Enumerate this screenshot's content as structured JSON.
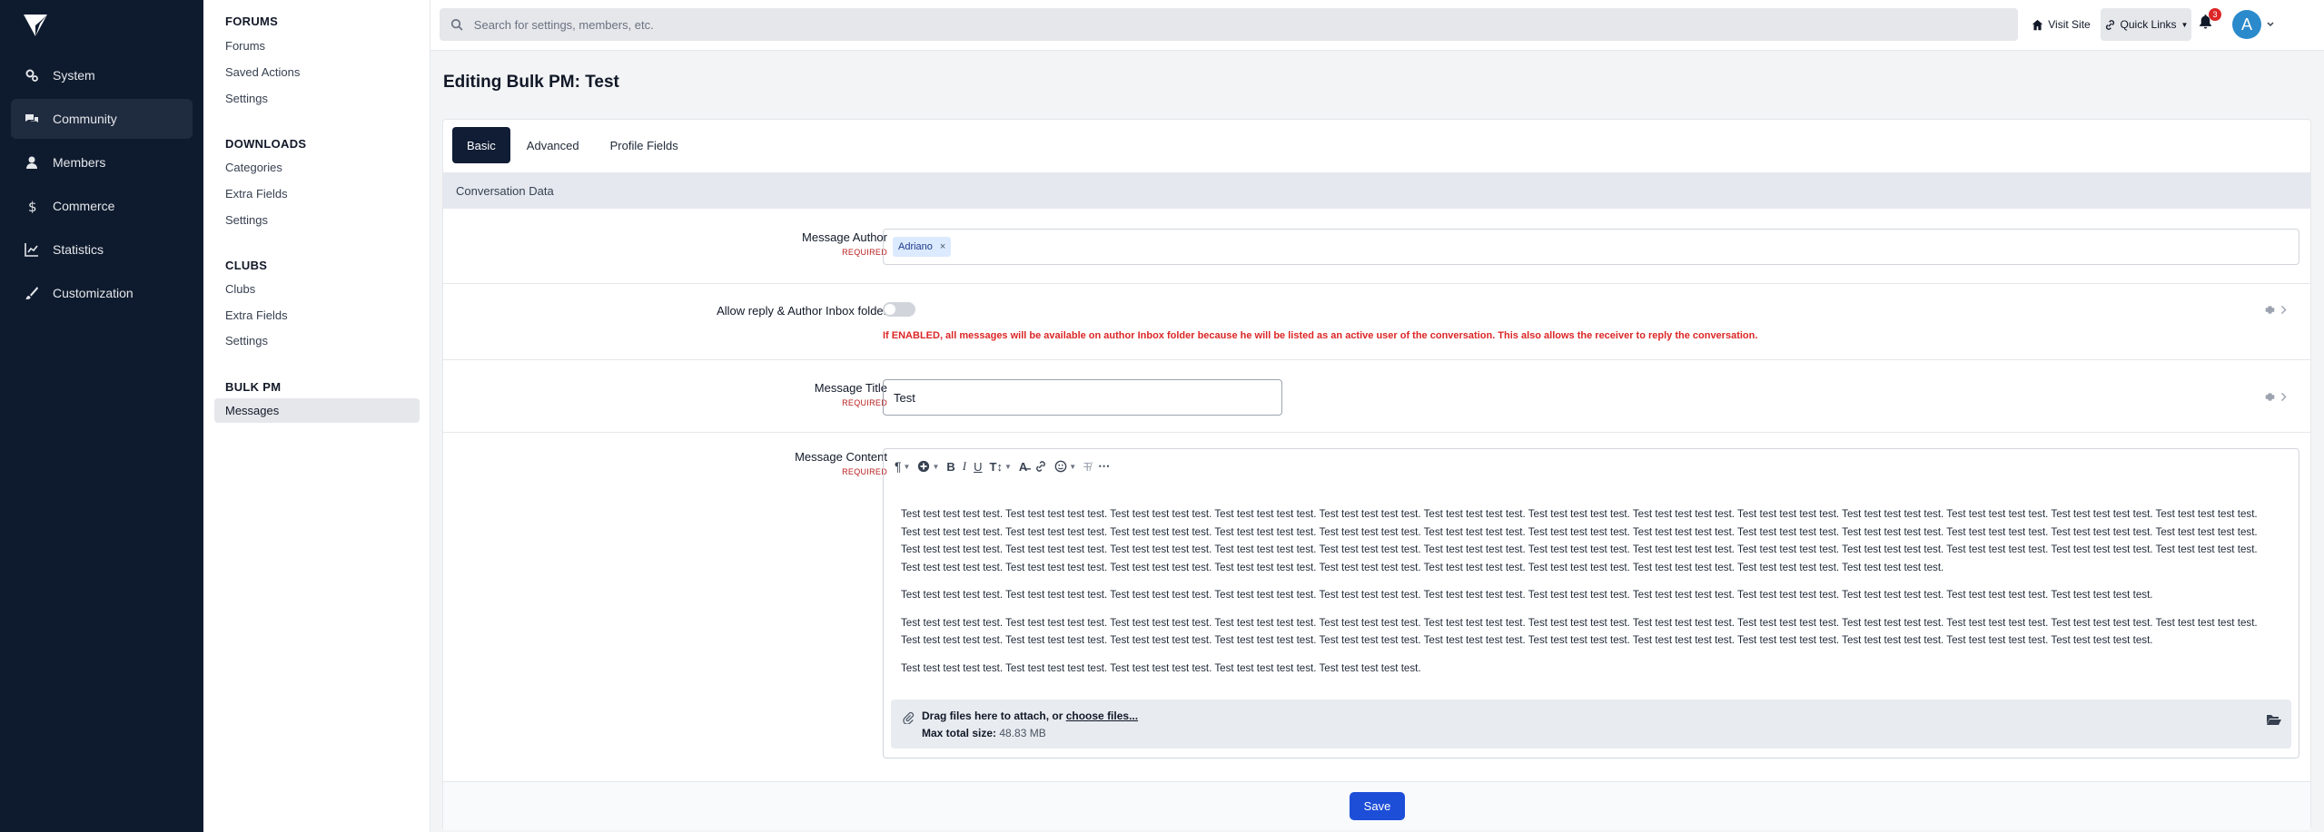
{
  "nav": {
    "items": [
      {
        "label": "System",
        "icon": "gears-icon"
      },
      {
        "label": "Community",
        "icon": "comments-icon",
        "active": true
      },
      {
        "label": "Members",
        "icon": "user-icon"
      },
      {
        "label": "Commerce",
        "icon": "dollar-icon"
      },
      {
        "label": "Statistics",
        "icon": "chart-line-icon"
      },
      {
        "label": "Customization",
        "icon": "paintbrush-icon"
      }
    ]
  },
  "subnav": {
    "groups": [
      {
        "title": "FORUMS",
        "items": [
          "Forums",
          "Saved Actions",
          "Settings"
        ]
      },
      {
        "title": "DOWNLOADS",
        "items": [
          "Categories",
          "Extra Fields",
          "Settings"
        ]
      },
      {
        "title": "CLUBS",
        "items": [
          "Clubs",
          "Extra Fields",
          "Settings"
        ]
      },
      {
        "title": "BULK PM",
        "items": [
          "Messages"
        ]
      }
    ]
  },
  "topbar": {
    "search_placeholder": "Search for settings, members, etc.",
    "visit_site": "Visit Site",
    "quick_links": "Quick Links",
    "notification_count": "3",
    "avatar_letter": "A"
  },
  "page": {
    "title": "Editing Bulk PM: Test",
    "tabs": [
      "Basic",
      "Advanced",
      "Profile Fields"
    ],
    "section": "Conversation Data",
    "required": "REQUIRED",
    "fields": {
      "author_label": "Message Author",
      "author_token": "Adriano",
      "inbox_label": "Allow reply & Author Inbox folder",
      "inbox_warning": "If ENABLED, all messages will be available on author Inbox folder because he will be listed as an active user of the conversation. This also allows the receiver to reply the conversation.",
      "title_label": "Message Title",
      "title_value": "Test",
      "content_label": "Message Content"
    },
    "content_paragraphs": [
      "Test test test test test. Test test test test test. Test test test test test. Test test test test test. Test test test test test. Test test test test test. Test test test test test. Test test test test test. Test test test test test. Test test test test test. Test test test test test. Test test test test test. Test test test test test. Test test test test test. Test test test test test. Test test test test test. Test test test test test. Test test test test test. Test test test test test. Test test test test test. Test test test test test. Test test test test test. Test test test test test. Test test test test test. Test test test test test. Test test test test test. Test test test test test. Test test test test test. Test test test test test. Test test test test test. Test test test test test. Test test test test test. Test test test test test. Test test test test test. Test test test test test. Test test test test test. Test test test test test. Test test test test test. Test test test test test. Test test test test test. Test test test test test. Test test test test test. Test test test test test. Test test test test test. Test test test test test. Test test test test test. Test test test test test. Test test test test test. Test test test test test.",
      "Test test test test test. Test test test test test. Test test test test test. Test test test test test. Test test test test test. Test test test test test. Test test test test test. Test test test test test. Test test test test test. Test test test test test. Test test test test test. Test test test test test.",
      "Test test test test test. Test test test test test. Test test test test test. Test test test test test. Test test test test test. Test test test test test. Test test test test test. Test test test test test. Test test test test test. Test test test test test. Test test test test test. Test test test test test. Test test test test test. Test test test test test. Test test test test test. Test test test test test. Test test test test test. Test test test test test. Test test test test test. Test test test test test. Test test test test test. Test test test test test. Test test test test test. Test test test test test. Test test test test test.",
      "Test test test test test. Test test test test test. Test test test test test. Test test test test test. Test test test test test."
    ],
    "attach": {
      "text": "Drag files here to attach, or",
      "link": "choose files...",
      "max_label": "Max total size:",
      "max_value": "48.83 MB"
    },
    "save": "Save"
  },
  "colors": {
    "sidebar_bg": "#0e1b2e",
    "accent": "#1d4ed8",
    "tab_active": "#111d35",
    "required": "#b91c1c",
    "warning": "#dc2626"
  }
}
